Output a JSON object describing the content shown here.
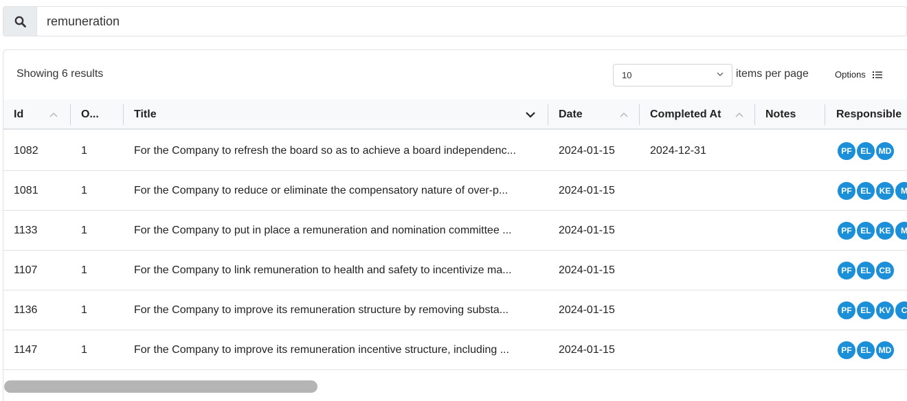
{
  "search": {
    "value": "remuneration",
    "icon": "search-icon"
  },
  "toolbar": {
    "results_text": "Showing 6 results",
    "per_page_value": "10",
    "per_page_label": "items per page",
    "options_label": "Options"
  },
  "table": {
    "columns": {
      "id": "Id",
      "order": "O...",
      "title": "Title",
      "date": "Date",
      "completed_at": "Completed At",
      "notes": "Notes",
      "responsible": "Responsible"
    },
    "rows": [
      {
        "id": "1082",
        "order": "1",
        "title": "For the Company to refresh the board so as to achieve a board independenc...",
        "date": "2024-01-15",
        "completed_at": "2024-12-31",
        "notes": "",
        "responsible": [
          "PF",
          "EL",
          "MD"
        ]
      },
      {
        "id": "1081",
        "order": "1",
        "title": "For the Company to reduce or eliminate the compensatory nature of over-p...",
        "date": "2024-01-15",
        "completed_at": "",
        "notes": "",
        "responsible": [
          "PF",
          "EL",
          "KE",
          "M"
        ]
      },
      {
        "id": "1133",
        "order": "1",
        "title": "For the Company to put in place a remuneration and nomination committee ...",
        "date": "2024-01-15",
        "completed_at": "",
        "notes": "",
        "responsible": [
          "PF",
          "EL",
          "KE",
          "M"
        ]
      },
      {
        "id": "1107",
        "order": "1",
        "title": "For the Company to link remuneration to health and safety to incentivize ma...",
        "date": "2024-01-15",
        "completed_at": "",
        "notes": "",
        "responsible": [
          "PF",
          "EL",
          "CB"
        ]
      },
      {
        "id": "1136",
        "order": "1",
        "title": "For the Company to improve its remuneration structure by removing substa...",
        "date": "2024-01-15",
        "completed_at": "",
        "notes": "",
        "responsible": [
          "PF",
          "EL",
          "KV",
          "C"
        ]
      },
      {
        "id": "1147",
        "order": "1",
        "title": "For the Company to improve its remuneration incentive structure, including ...",
        "date": "2024-01-15",
        "completed_at": "",
        "notes": "",
        "responsible": [
          "PF",
          "EL",
          "MD"
        ]
      }
    ]
  },
  "colors": {
    "accent": "#1b8fd8",
    "header_bg": "#f8f9fa",
    "scrollbar": "#b5b5b5"
  }
}
